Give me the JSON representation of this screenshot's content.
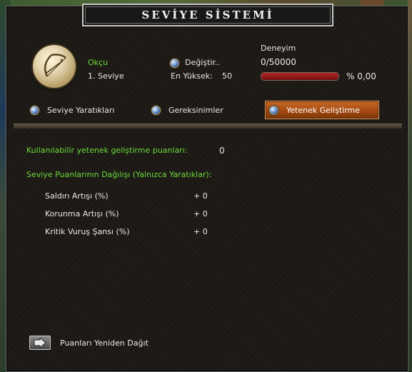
{
  "window": {
    "title": "SEVİYE SİSTEMİ"
  },
  "character": {
    "class_name": "Okçu",
    "level_label": "1. Seviye",
    "change_label": "Değiştir..",
    "highest_label": "En Yüksek:",
    "highest_value": "50",
    "class_icon": "bow-icon"
  },
  "experience": {
    "label": "Deneyim",
    "value_text": "0/50000",
    "percent_text": "% 0,00",
    "progress_fraction": 0.0,
    "bar_color": "#b02828"
  },
  "tabs": [
    {
      "label": "Seviye Yaratıkları",
      "active": false
    },
    {
      "label": "Gereksinimler",
      "active": false
    },
    {
      "label": "Yetenek Geliştirme",
      "active": true
    }
  ],
  "skills": {
    "available_label": "Kullanılabilir yetenek geliştirme puanları:",
    "available_value": "0",
    "distribution_label": "Seviye Puanlarının Dağılışı (Yalnızca Yaratıklar):",
    "stats": [
      {
        "label": "Saldırı Artışı (%)",
        "value": "+ 0"
      },
      {
        "label": "Korunma Artışı (%)",
        "value": "+ 0"
      },
      {
        "label": "Kritik Vuruş Şansı (%)",
        "value": "+ 0"
      }
    ]
  },
  "reset": {
    "label": "Puanları Yeniden Dağıt",
    "icon": "arrow-right-icon"
  },
  "colors": {
    "accent_green": "#6bdb3a",
    "tab_active": "#a04810",
    "gem_blue": "#7fa4d8"
  }
}
